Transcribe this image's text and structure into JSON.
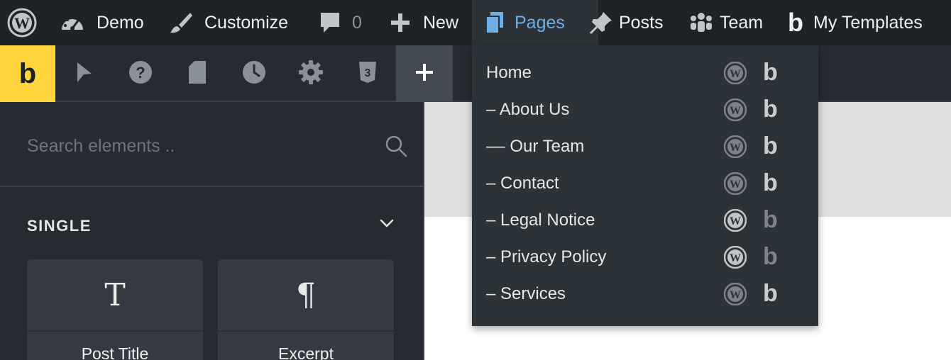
{
  "admin_bar": {
    "items": [
      {
        "name": "wordpress-logo",
        "label": ""
      },
      {
        "name": "site-name",
        "label": "Demo"
      },
      {
        "name": "customize",
        "label": "Customize"
      },
      {
        "name": "comments",
        "label": "0"
      },
      {
        "name": "new-content",
        "label": "New"
      },
      {
        "name": "pages",
        "label": "Pages"
      },
      {
        "name": "posts",
        "label": "Posts"
      },
      {
        "name": "team",
        "label": "Team"
      },
      {
        "name": "my-templates",
        "label": "My Templates"
      }
    ],
    "active_color": "#72aee6"
  },
  "toolbar": {
    "logo_letter": "b",
    "logo_color": "#ffd53e",
    "icons": [
      "elements-cursor-icon",
      "help-icon",
      "page-icon",
      "history-icon",
      "settings-icon",
      "css3-icon",
      "add-icon"
    ]
  },
  "panel": {
    "search_placeholder": "Search elements ..",
    "group_title": "SINGLE",
    "elements": [
      {
        "icon_glyph": "T",
        "label": "Post Title"
      },
      {
        "icon_glyph": "¶",
        "label": "Excerpt"
      }
    ]
  },
  "pages_menu": {
    "items": [
      {
        "label": "Home",
        "bricks_dim": false
      },
      {
        "label": "– About Us",
        "bricks_dim": false
      },
      {
        "label": "–– Our Team",
        "bricks_dim": false
      },
      {
        "label": "– Contact",
        "bricks_dim": false
      },
      {
        "label": "– Legal Notice",
        "bricks_dim": true
      },
      {
        "label": "– Privacy Policy",
        "bricks_dim": true
      },
      {
        "label": "– Services",
        "bricks_dim": false
      }
    ],
    "bricks_glyph": "b"
  }
}
